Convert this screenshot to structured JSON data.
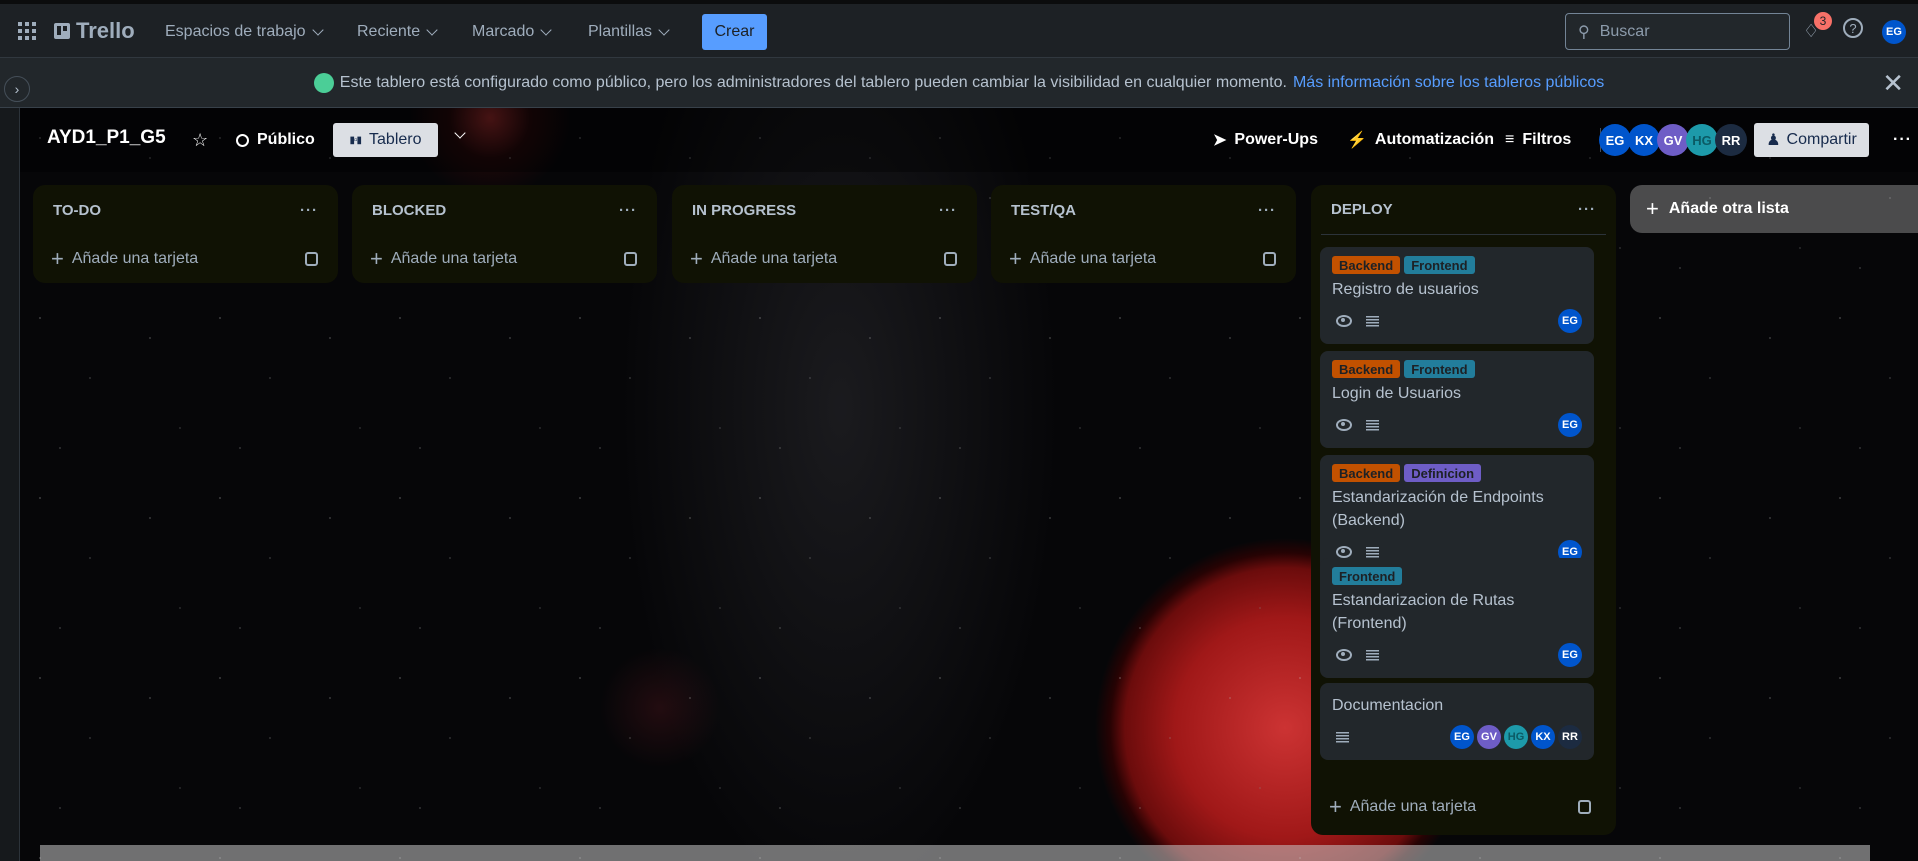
{
  "topbar": {
    "logo": "Trello",
    "nav": [
      "Espacios de trabajo",
      "Reciente",
      "Marcado",
      "Plantillas"
    ],
    "create": "Crear",
    "search_placeholder": "Buscar",
    "notification_count": "3",
    "user_initials": "EG"
  },
  "banner": {
    "text": "Este tablero está configurado como público, pero los administradores del tablero pueden cambiar la visibilidad en cualquier momento.",
    "link": "Más información sobre los tableros públicos"
  },
  "board": {
    "title": "AYD1_P1_G5",
    "visibility": "Público",
    "view": "Tablero",
    "powerups": "Power-Ups",
    "automation": "Automatización",
    "filters": "Filtros",
    "share": "Compartir",
    "members": [
      {
        "i": "EG",
        "c": "#0055cc"
      },
      {
        "i": "KX",
        "c": "#0055cc"
      },
      {
        "i": "GV",
        "c": "#6e5dc6"
      },
      {
        "i": "HG",
        "c": "#1d9aaa"
      },
      {
        "i": "RR",
        "c": "#1c2b41"
      }
    ]
  },
  "add_card": "Añade una tarjeta",
  "add_list": "Añade otra lista",
  "lists": [
    {
      "title": "TO-DO"
    },
    {
      "title": "BLOCKED"
    },
    {
      "title": "IN PROGRESS"
    },
    {
      "title": "TEST/QA"
    },
    {
      "title": "DEPLOY"
    }
  ],
  "label_colors": {
    "Backend": "#c25100",
    "Frontend": "#227d9b",
    "Definicion": "#6e5dc6"
  },
  "deploy_cards": [
    {
      "labels": [
        "Backend",
        "Frontend"
      ],
      "title": "Registro de usuarios",
      "watch": true,
      "members": [
        "EG"
      ]
    },
    {
      "labels": [
        "Backend",
        "Frontend"
      ],
      "title": "Login de Usuarios",
      "watch": true,
      "members": [
        "EG"
      ]
    },
    {
      "labels": [
        "Backend",
        "Definicion"
      ],
      "title": "Estandarización de Endpoints (Backend)",
      "watch": true,
      "members": [
        "EG"
      ]
    },
    {
      "labels": [
        "Frontend"
      ],
      "title": "Estandarizacion de Rutas (Frontend)",
      "watch": true,
      "members": [
        "EG"
      ]
    },
    {
      "labels": [],
      "title": "Documentacion",
      "watch": false,
      "members": [
        "EG",
        "GV",
        "HG",
        "KX",
        "RR"
      ]
    }
  ],
  "member_colors": {
    "EG": "#0055cc",
    "GV": "#6e5dc6",
    "HG": "#1d9aaa",
    "KX": "#0055cc",
    "RR": "#1c2b41"
  }
}
